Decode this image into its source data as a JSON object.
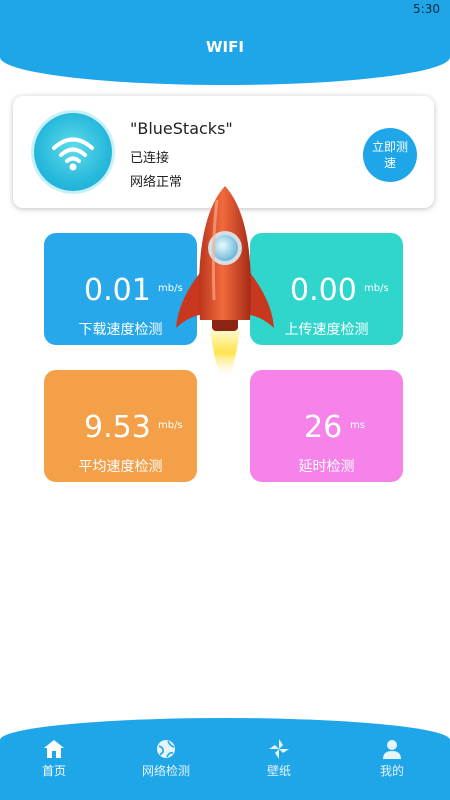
{
  "status_bar": {
    "time": "5:30"
  },
  "header": {
    "title": "WIFI"
  },
  "wifi_card": {
    "ssid": "\"BlueStacks\"",
    "status": "已连接",
    "network": "网络正常",
    "test_button_label": "立即测速"
  },
  "tiles": [
    {
      "value": "0.01",
      "unit": "mb/s",
      "label": "下载速度检测",
      "color": "#27a8ea"
    },
    {
      "value": "0.00",
      "unit": "mb/s",
      "label": "上传速度检测",
      "color": "#30d6cc"
    },
    {
      "value": "9.53",
      "unit": "mb/s",
      "label": "平均速度检测",
      "color": "#f3a049"
    },
    {
      "value": "26",
      "unit": "ms",
      "label": "延时检测",
      "color": "#f583e9"
    }
  ],
  "bottom_nav": [
    {
      "label": "首页",
      "icon": "home-icon"
    },
    {
      "label": "网络检测",
      "icon": "globe-icon"
    },
    {
      "label": "壁纸",
      "icon": "pinwheel-icon"
    },
    {
      "label": "我的",
      "icon": "person-icon"
    }
  ],
  "colors": {
    "accent": "#1fa6e8"
  }
}
